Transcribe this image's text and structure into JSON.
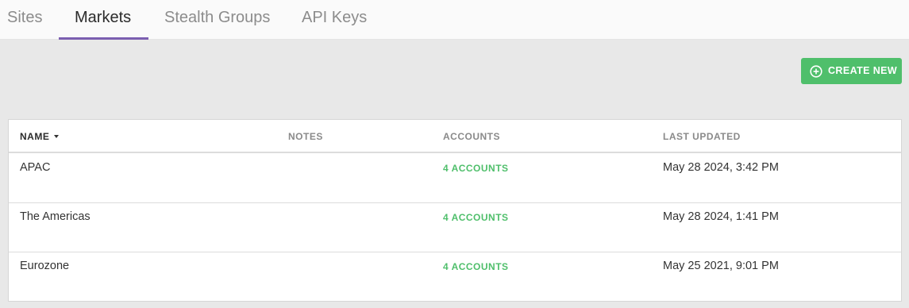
{
  "tabs": [
    {
      "label": "Sites",
      "active": false
    },
    {
      "label": "Markets",
      "active": true
    },
    {
      "label": "Stealth Groups",
      "active": false
    },
    {
      "label": "API Keys",
      "active": false
    }
  ],
  "create_button": {
    "label": "CREATE NEW",
    "icon": "plus-circle-icon"
  },
  "table": {
    "columns": {
      "name": "NAME",
      "notes": "NOTES",
      "accounts": "ACCOUNTS",
      "last_updated": "LAST UPDATED"
    },
    "sort": {
      "column": "name",
      "direction": "descending",
      "icon": "caret-down-icon"
    },
    "rows": [
      {
        "name": "APAC",
        "notes": "",
        "accounts": "4 ACCOUNTS",
        "last_updated": "May 28 2024, 3:42 PM"
      },
      {
        "name": "The Americas",
        "notes": "",
        "accounts": "4 ACCOUNTS",
        "last_updated": "May 28 2024, 1:41 PM"
      },
      {
        "name": "Eurozone",
        "notes": "",
        "accounts": "4 ACCOUNTS",
        "last_updated": "May 25 2021, 9:01 PM"
      }
    ]
  },
  "colors": {
    "accent_tab": "#7b5fb0",
    "create_button": "#4fbf6b",
    "accounts_link": "#4fbf6b",
    "page_background": "#e8e8e8"
  }
}
